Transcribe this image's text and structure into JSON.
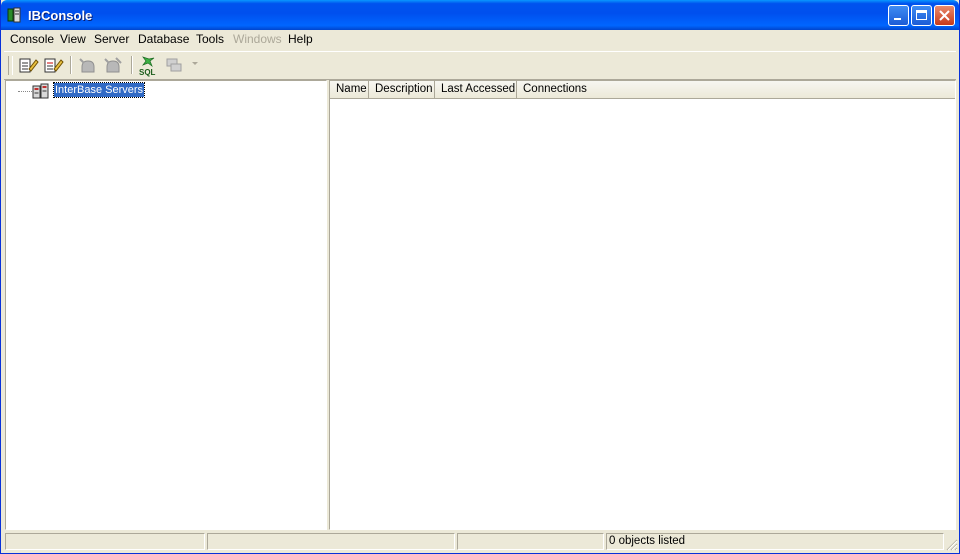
{
  "window": {
    "title": "IBConsole"
  },
  "menu": {
    "items": [
      {
        "label": "Console",
        "enabled": true
      },
      {
        "label": "View",
        "enabled": true
      },
      {
        "label": "Server",
        "enabled": true
      },
      {
        "label": "Database",
        "enabled": true
      },
      {
        "label": "Tools",
        "enabled": true
      },
      {
        "label": "Windows",
        "enabled": false
      },
      {
        "label": "Help",
        "enabled": true
      }
    ]
  },
  "toolbar": {
    "buttons": [
      {
        "icon": "register-server-icon",
        "enabled": true
      },
      {
        "icon": "unregister-server-icon",
        "enabled": true
      },
      {
        "icon": "connect-icon",
        "enabled": false
      },
      {
        "icon": "disconnect-icon",
        "enabled": false
      },
      {
        "icon": "sql-icon",
        "enabled": true
      },
      {
        "icon": "windows-list-icon",
        "enabled": false
      }
    ],
    "sql_label": "SQL"
  },
  "tree": {
    "root": {
      "label": "InterBase Servers",
      "selected": true,
      "icon": "servers-icon"
    }
  },
  "list": {
    "columns": [
      "Name",
      "Description",
      "Last Accessed",
      "Connections"
    ],
    "rows": []
  },
  "status": {
    "panes": [
      "",
      "",
      "",
      "0 objects listed"
    ]
  },
  "colors": {
    "titlebar": "#0054e3",
    "face": "#ece9d8",
    "selection": "#316ac5"
  }
}
